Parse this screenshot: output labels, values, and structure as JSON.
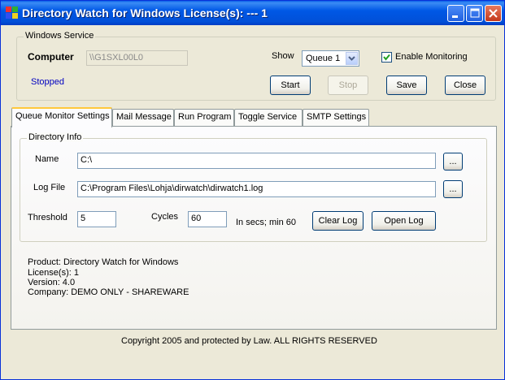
{
  "window": {
    "title": "Directory Watch for Windows License(s): --- 1"
  },
  "service_group": {
    "legend": "Windows Service",
    "computer_label": "Computer",
    "computer_value": "\\\\G1SXL00L0",
    "status": "Stopped",
    "show_label": "Show",
    "show_selected": "Queue 1",
    "enable_monitoring_label": "Enable Monitoring",
    "enable_monitoring_checked": true,
    "buttons": {
      "start": "Start",
      "stop": "Stop",
      "save": "Save",
      "close": "Close"
    }
  },
  "tabs": [
    {
      "label": "Queue Monitor Settings",
      "active": true
    },
    {
      "label": "Mail Message",
      "active": false
    },
    {
      "label": "Run Program",
      "active": false
    },
    {
      "label": "Toggle Service",
      "active": false
    },
    {
      "label": "SMTP Settings",
      "active": false
    }
  ],
  "directory_info": {
    "legend": "Directory Info",
    "name_label": "Name",
    "name_value": "C:\\",
    "logfile_label": "Log File",
    "logfile_value": "C:\\Program Files\\Lohja\\dirwatch\\dirwatch1.log",
    "browse_label": "...",
    "threshold_label": "Threshold",
    "threshold_value": "5",
    "cycles_label": "Cycles",
    "cycles_value": "60",
    "cycles_hint": "In secs; min 60",
    "clear_log": "Clear Log",
    "open_log": "Open Log"
  },
  "product_info": {
    "product": "Product: Directory Watch for Windows",
    "licenses": "License(s): 1",
    "version": "Version: 4.0",
    "company": "Company: DEMO ONLY - SHAREWARE"
  },
  "footer": {
    "copyright": "Copyright 2005 and protected by Law.  ALL RIGHTS RESERVED"
  },
  "colors": {
    "titlebar": "#0058e6",
    "status_text": "#0000c0",
    "face": "#ece9d8"
  }
}
